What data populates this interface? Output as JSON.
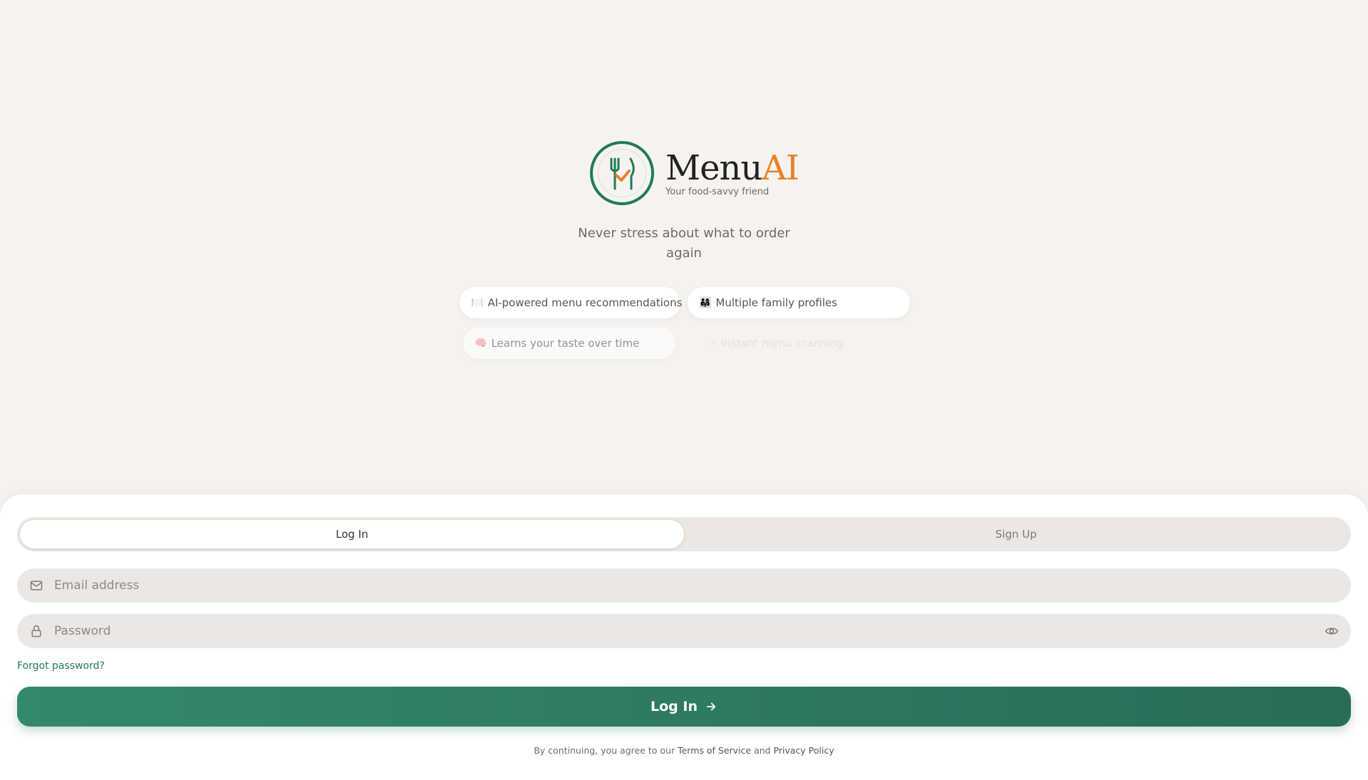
{
  "brand": {
    "name_main": "Menu",
    "name_accent": "AI",
    "tagline": "Your food-savvy friend"
  },
  "hero": {
    "headline": "Never stress about what to order again",
    "features": [
      {
        "emoji": "🍽️",
        "label": "AI-powered menu recommendations"
      },
      {
        "emoji": "👨‍👩‍👧",
        "label": "Multiple family profiles"
      },
      {
        "emoji": "🧠",
        "label": "Learns your taste over time"
      },
      {
        "emoji": "⚡",
        "label": "Instant menu scanning"
      }
    ]
  },
  "auth": {
    "tabs": [
      {
        "label": "Log In",
        "active": true
      },
      {
        "label": "Sign Up",
        "active": false
      }
    ],
    "email_placeholder": "Email address",
    "password_placeholder": "Password",
    "forgot_label": "Forgot password?",
    "submit_label": "Log In",
    "legal_prefix": "By continuing, you agree to our ",
    "terms_label": "Terms of Service",
    "legal_and": " and ",
    "privacy_label": "Privacy Policy"
  },
  "colors": {
    "primary": "#2e7a63",
    "accent": "#e5812b",
    "background": "#f6f3ee"
  }
}
